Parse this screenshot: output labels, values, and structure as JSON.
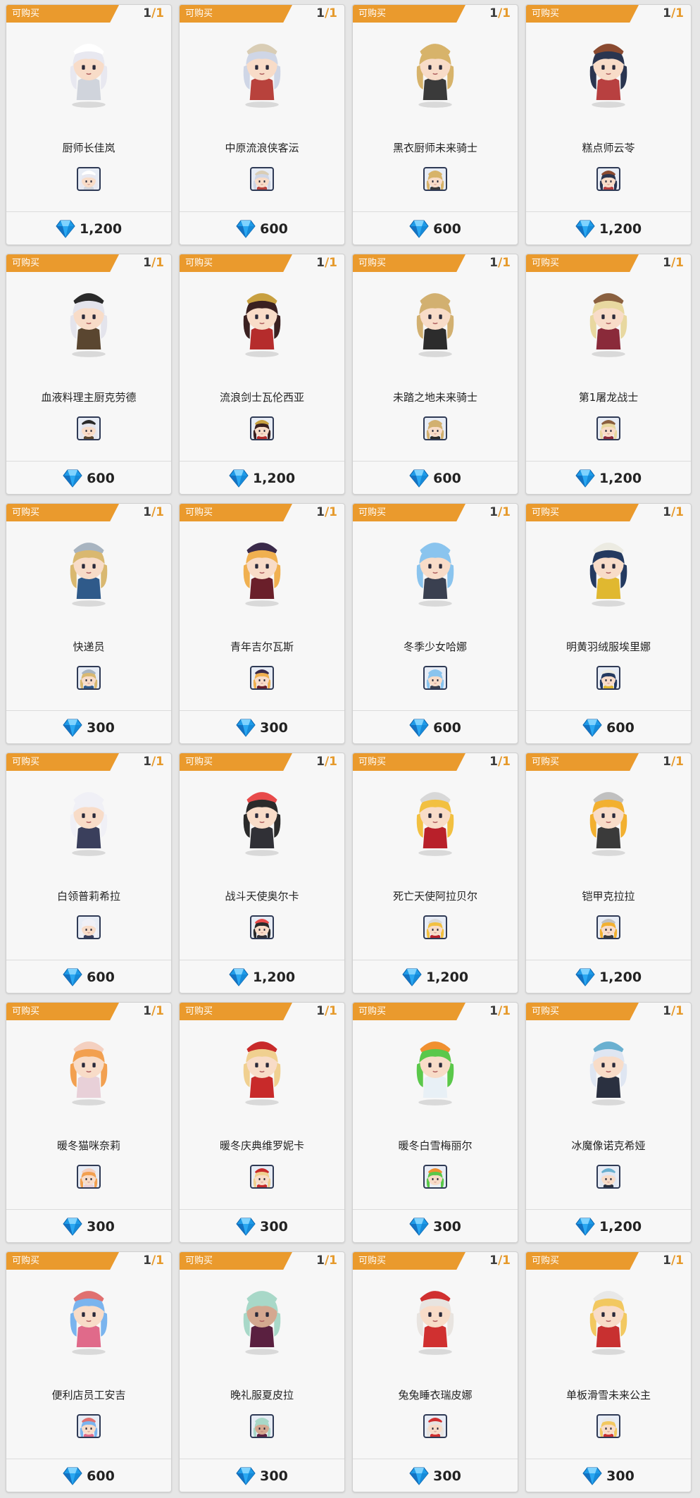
{
  "shop": {
    "colors": {
      "tag": "#ea9a2d",
      "limit_accent": "#e69a2c",
      "card_bg": "#f7f7f7",
      "gem": "#1e9be8"
    },
    "items": [
      {
        "tag": "可购买",
        "bought": "1",
        "sep": "/",
        "max": "1",
        "name": "厨师长佳岚",
        "price": "1,200",
        "hair": "#e8e8f0",
        "outfit": "#d0d4dc",
        "hat": "#ffffff",
        "skin": "#f8dcc8"
      },
      {
        "tag": "可购买",
        "bought": "1",
        "sep": "/",
        "max": "1",
        "name": "中原流浪侠客沄",
        "price": "600",
        "hair": "#cfd6e6",
        "outfit": "#b8423c",
        "hat": "#d9cdb5",
        "skin": "#f8dcc8"
      },
      {
        "tag": "可购买",
        "bought": "1",
        "sep": "/",
        "max": "1",
        "name": "黑衣厨师未来骑士",
        "price": "600",
        "hair": "#d7b36a",
        "outfit": "#3a3a3a",
        "hat": "#d7b36a",
        "skin": "#f8dcc8"
      },
      {
        "tag": "可购买",
        "bought": "1",
        "sep": "/",
        "max": "1",
        "name": "糕点师云苓",
        "price": "1,200",
        "hair": "#2a3550",
        "outfit": "#b84040",
        "hat": "#8a4a30",
        "skin": "#f8dcc8"
      },
      {
        "tag": "可购买",
        "bought": "1",
        "sep": "/",
        "max": "1",
        "name": "血液料理主厨克劳德",
        "price": "600",
        "hair": "#e4e4ec",
        "outfit": "#5a4630",
        "hat": "#2a2a2a",
        "skin": "#f8dcc8"
      },
      {
        "tag": "可购买",
        "bought": "1",
        "sep": "/",
        "max": "1",
        "name": "流浪剑士瓦伦西亚",
        "price": "1,200",
        "hair": "#3a2020",
        "outfit": "#b52c2c",
        "hat": "#c8a040",
        "skin": "#f8dcc8"
      },
      {
        "tag": "可购买",
        "bought": "1",
        "sep": "/",
        "max": "1",
        "name": "未踏之地未来骑士",
        "price": "600",
        "hair": "#d2b070",
        "outfit": "#2c2c2c",
        "hat": "#d2b070",
        "skin": "#f8dcc8"
      },
      {
        "tag": "可购买",
        "bought": "1",
        "sep": "/",
        "max": "1",
        "name": "第1屠龙战士",
        "price": "1,200",
        "hair": "#e8d8a0",
        "outfit": "#8a2a3a",
        "hat": "#8a6040",
        "skin": "#f8dcc8"
      },
      {
        "tag": "可购买",
        "bought": "1",
        "sep": "/",
        "max": "1",
        "name": "快递员",
        "price": "300",
        "hair": "#d9b870",
        "outfit": "#2f5a8a",
        "hat": "#a8b4c0",
        "skin": "#f8dcc8"
      },
      {
        "tag": "可购买",
        "bought": "1",
        "sep": "/",
        "max": "1",
        "name": "青年吉尔瓦斯",
        "price": "300",
        "hair": "#f0b050",
        "outfit": "#6a1f2a",
        "hat": "#3a2a4a",
        "skin": "#f8dcc8"
      },
      {
        "tag": "可购买",
        "bought": "1",
        "sep": "/",
        "max": "1",
        "name": "冬季少女哈娜",
        "price": "600",
        "hair": "#8ac4ee",
        "outfit": "#3a4050",
        "hat": "#8ac4ee",
        "skin": "#f8dcc8"
      },
      {
        "tag": "可购买",
        "bought": "1",
        "sep": "/",
        "max": "1",
        "name": "明黄羽绒服埃里娜",
        "price": "600",
        "hair": "#243a60",
        "outfit": "#e0b830",
        "hat": "#ecebe2",
        "skin": "#f8dcc8"
      },
      {
        "tag": "可购买",
        "bought": "1",
        "sep": "/",
        "max": "1",
        "name": "白领普莉希拉",
        "price": "600",
        "hair": "#f0f0f6",
        "outfit": "#3a3f5c",
        "hat": "#f0f0f6",
        "skin": "#f8dcc8"
      },
      {
        "tag": "可购买",
        "bought": "1",
        "sep": "/",
        "max": "1",
        "name": "战斗天使奥尔卡",
        "price": "1,200",
        "hair": "#2a2a2a",
        "outfit": "#303036",
        "hat": "#e84a4a",
        "skin": "#f8dcc8"
      },
      {
        "tag": "可购买",
        "bought": "1",
        "sep": "/",
        "max": "1",
        "name": "死亡天使阿拉贝尔",
        "price": "1,200",
        "hair": "#f2c040",
        "outfit": "#b8202a",
        "hat": "#d8d8d8",
        "skin": "#f8dcc8"
      },
      {
        "tag": "可购买",
        "bought": "1",
        "sep": "/",
        "max": "1",
        "name": "铠甲克拉拉",
        "price": "1,200",
        "hair": "#f2b030",
        "outfit": "#3a3a3a",
        "hat": "#c0c0c0",
        "skin": "#f8dcc8"
      },
      {
        "tag": "可购买",
        "bought": "1",
        "sep": "/",
        "max": "1",
        "name": "暖冬猫咪奈莉",
        "price": "300",
        "hair": "#f2a050",
        "outfit": "#e8d0d8",
        "hat": "#f4d0c0",
        "skin": "#f8dcc8"
      },
      {
        "tag": "可购买",
        "bought": "1",
        "sep": "/",
        "max": "1",
        "name": "暖冬庆典维罗妮卡",
        "price": "300",
        "hair": "#f0d090",
        "outfit": "#c82a2a",
        "hat": "#c82a2a",
        "skin": "#f8dcc8"
      },
      {
        "tag": "可购买",
        "bought": "1",
        "sep": "/",
        "max": "1",
        "name": "暖冬白雪梅丽尔",
        "price": "300",
        "hair": "#5ac84a",
        "outfit": "#e8f0f6",
        "hat": "#f09030",
        "skin": "#f8dcc8"
      },
      {
        "tag": "可购买",
        "bought": "1",
        "sep": "/",
        "max": "1",
        "name": "冰魔像诺克希娅",
        "price": "1,200",
        "hair": "#dfe6f2",
        "outfit": "#2a3040",
        "hat": "#6ab0d0",
        "skin": "#f8dcc8"
      },
      {
        "tag": "可购买",
        "bought": "1",
        "sep": "/",
        "max": "1",
        "name": "便利店员工安吉",
        "price": "600",
        "hair": "#7ab4ee",
        "outfit": "#e06a8a",
        "hat": "#e07070",
        "skin": "#f8dcc8"
      },
      {
        "tag": "可购买",
        "bought": "1",
        "sep": "/",
        "max": "1",
        "name": "晚礼服夏皮拉",
        "price": "300",
        "hair": "#a8d8c8",
        "outfit": "#5a2040",
        "hat": "#a8d8c8",
        "skin": "#d4a890"
      },
      {
        "tag": "可购买",
        "bought": "1",
        "sep": "/",
        "max": "1",
        "name": "兔兔睡衣瑞皮娜",
        "price": "300",
        "hair": "#e8e4e0",
        "outfit": "#d03030",
        "hat": "#d03030",
        "skin": "#f8dcc8"
      },
      {
        "tag": "可购买",
        "bought": "1",
        "sep": "/",
        "max": "1",
        "name": "单板滑雪未来公主",
        "price": "300",
        "hair": "#f2c860",
        "outfit": "#c83030",
        "hat": "#e8e8e8",
        "skin": "#f8dcc8"
      }
    ]
  }
}
